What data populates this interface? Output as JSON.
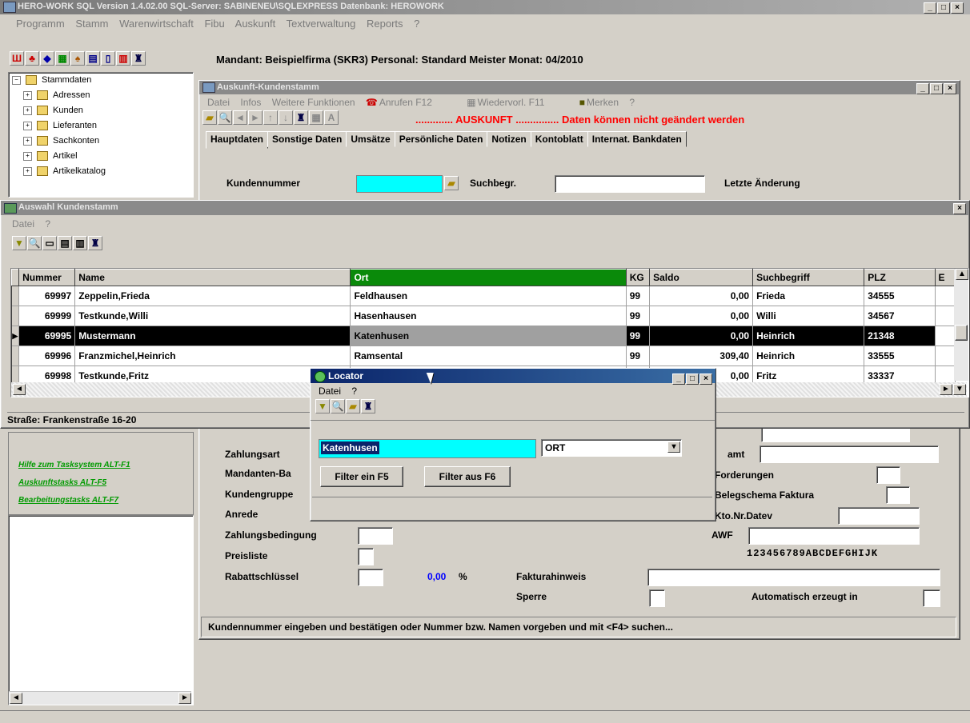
{
  "app": {
    "title": "HERO-WORK SQL  Version 1.4.02.00 SQL-Server: SABINENEU\\SQLEXPRESS Datenbank: HEROWORK",
    "menu": [
      "Programm",
      "Stamm",
      "Warenwirtschaft",
      "Fibu",
      "Auskunft",
      "Textverwaltung",
      "Reports",
      "?"
    ],
    "info_line": "Mandant: Beispielfirma (SKR3)  Personal: Standard Meister  Monat: 04/2010"
  },
  "tree": {
    "root": "Stammdaten",
    "items": [
      "Adressen",
      "Kunden",
      "Lieferanten",
      "Sachkonten",
      "Artikel",
      "Artikelkatalog"
    ]
  },
  "task_links": [
    "Hilfe zum Tasksystem ALT-F1",
    "Auskunftstasks ALT-F5",
    "Bearbeitungstasks ALT-F7"
  ],
  "kunden_window": {
    "title": "Auskunft-Kundenstamm",
    "menu": [
      "Datei",
      "Infos",
      "Weitere Funktionen"
    ],
    "anrufen": "Anrufen F12",
    "wiedervorl": "Wiedervorl. F11",
    "merken": "Merken",
    "help": "?",
    "auskunft_notice": "............. AUSKUNFT ............... Daten können nicht geändert werden",
    "tabs": [
      "Hauptdaten",
      "Sonstige Daten",
      "Umsätze",
      "Persönliche Daten",
      "Notizen",
      "Kontoblatt",
      "Internat. Bankdaten"
    ],
    "kundennummer_label": "Kundennummer",
    "suchbegr_label": "Suchbegr.",
    "letzte_aenderung_label": "Letzte Änderung",
    "zahlungsart_label": "Zahlungsart",
    "mandanten_label": "Mandanten-Ba",
    "kundengruppe_label": "Kundengruppe",
    "anrede_label": "Anrede",
    "zahlungsbedingung_label": "Zahlungsbedingung",
    "preisliste_label": "Preisliste",
    "rabattschluessel_label": "Rabattschlüssel",
    "rabatt_value": "0,00",
    "percent": "%",
    "fakturahinweis_label": "Fakturahinweis",
    "sperre_label": "Sperre",
    "amt_label": "amt",
    "forderungen_label": "Forderungen",
    "belegschema_label": "Belegschema Faktura",
    "ktonr_label": "Kto.Nr.Datev",
    "awf_label": "AWF",
    "awf_chars": "123456789ABCDEFGHIJK",
    "auto_erzeugt_label": "Automatisch erzeugt in",
    "status_text": "Kundennummer eingeben und bestätigen oder Nummer bzw. Namen vorgeben und mit <F4> suchen..."
  },
  "auswahl_window": {
    "title": "Auswahl Kundenstamm",
    "menu": [
      "Datei",
      "?"
    ],
    "columns": [
      "Nummer",
      "Name",
      "Ort",
      "KG",
      "Saldo",
      "Suchbegriff",
      "PLZ",
      "E"
    ],
    "rows": [
      {
        "nummer": "69997",
        "name": "Zeppelin,Frieda",
        "ort": "Feldhausen",
        "kg": "99",
        "saldo": "0,00",
        "such": "Frieda",
        "plz": "34555"
      },
      {
        "nummer": "69999",
        "name": "Testkunde,Willi",
        "ort": "Hasenhausen",
        "kg": "99",
        "saldo": "0,00",
        "such": "Willi",
        "plz": "34567"
      },
      {
        "nummer": "69995",
        "name": "Mustermann",
        "ort": "Katenhusen",
        "kg": "99",
        "saldo": "0,00",
        "such": "Heinrich",
        "plz": "21348"
      },
      {
        "nummer": "69996",
        "name": "Franzmichel,Heinrich",
        "ort": "Ramsental",
        "kg": "99",
        "saldo": "309,40",
        "such": "Heinrich",
        "plz": "33555"
      },
      {
        "nummer": "69998",
        "name": "Testkunde,Fritz",
        "ort": "",
        "kg": "",
        "saldo": "0,00",
        "such": "Fritz",
        "plz": "33337"
      }
    ],
    "selected_row": 2,
    "strasse": "Straße: Frankenstraße 16-20"
  },
  "locator": {
    "title": "Locator",
    "menu": [
      "Datei",
      "?"
    ],
    "search_value": "Katenhusen",
    "field_select": "ORT",
    "filter_on": "Filter ein F5",
    "filter_off": "Filter aus F6"
  },
  "colors": {
    "ort_header": "#0a8a0a",
    "highlight": "#00ffff",
    "notice_red": "#ff0000",
    "link_green": "#009a00"
  }
}
